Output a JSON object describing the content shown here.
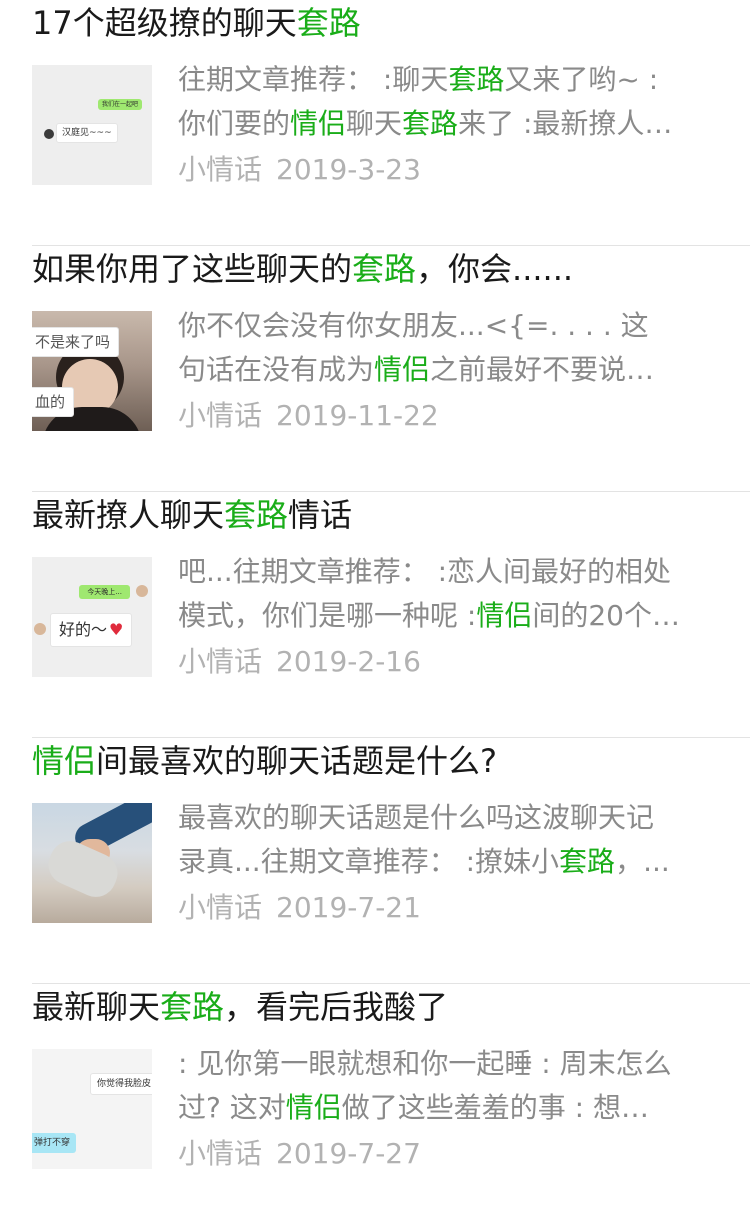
{
  "articles": [
    {
      "title_parts": [
        {
          "text": "17个超级撩的聊天",
          "hl": false
        },
        {
          "text": "套路",
          "hl": true
        }
      ],
      "desc_lines": [
        [
          {
            "text": "往期文章推荐：  :聊天",
            "hl": false
          },
          {
            "text": "套路",
            "hl": true
          },
          {
            "text": "又来了哟~ :",
            "hl": false
          }
        ],
        [
          {
            "text": "你们要的",
            "hl": false
          },
          {
            "text": "情侣",
            "hl": true
          },
          {
            "text": "聊天",
            "hl": false
          },
          {
            "text": "套路",
            "hl": true
          },
          {
            "text": "来了 :最新撩人…",
            "hl": false
          }
        ]
      ],
      "source": "小情话",
      "date": "2019-3-23",
      "thumb": {
        "kind": "chat1",
        "green_text": "我们在一起吧",
        "white_text": "汉庭见~~~"
      }
    },
    {
      "title_parts": [
        {
          "text": "如果你用了这些聊天的",
          "hl": false
        },
        {
          "text": "套路",
          "hl": true
        },
        {
          "text": "，你会......",
          "hl": false
        }
      ],
      "desc_lines": [
        [
          {
            "text": "你不仅会没有你女朋友...<{=.   .   .   .   这",
            "hl": false
          }
        ],
        [
          {
            "text": "句话在没有成为",
            "hl": false
          },
          {
            "text": "情侣",
            "hl": true
          },
          {
            "text": "之前最好不要说…",
            "hl": false
          }
        ]
      ],
      "source": "小情话",
      "date": "2019-11-22",
      "thumb": {
        "kind": "photo-girl",
        "top_text": "不是来了吗",
        "bottom_text": "血的"
      }
    },
    {
      "title_parts": [
        {
          "text": "最新撩人聊天",
          "hl": false
        },
        {
          "text": "套路",
          "hl": true
        },
        {
          "text": "情话",
          "hl": false
        }
      ],
      "desc_lines": [
        [
          {
            "text": "吧...往期文章推荐：  :恋人间最好的相处",
            "hl": false
          }
        ],
        [
          {
            "text": "模式，你们是哪一种呢 :",
            "hl": false
          },
          {
            "text": "情侣",
            "hl": true
          },
          {
            "text": "间的20个…",
            "hl": false
          }
        ]
      ],
      "source": "小情话",
      "date": "2019-2-16",
      "thumb": {
        "kind": "chat2",
        "green_text": "今天晚上...",
        "white_text": "好的～"
      }
    },
    {
      "title_parts": [
        {
          "text": "情侣",
          "hl": true
        },
        {
          "text": "间最喜欢的聊天话题是什么?",
          "hl": false
        }
      ],
      "desc_lines": [
        [
          {
            "text": "最喜欢的聊天话题是什么吗这波聊天记",
            "hl": false
          }
        ],
        [
          {
            "text": "录真...往期文章推荐：  :撩妹小",
            "hl": false
          },
          {
            "text": "套路",
            "hl": true
          },
          {
            "text": "，...",
            "hl": false
          }
        ]
      ],
      "source": "小情话",
      "date": "2019-7-21",
      "thumb": {
        "kind": "photo-hands"
      }
    },
    {
      "title_parts": [
        {
          "text": "最新聊天",
          "hl": false
        },
        {
          "text": "套路",
          "hl": true
        },
        {
          "text": "，看完后我酸了",
          "hl": false
        }
      ],
      "desc_lines": [
        [
          {
            "text": ": 见你第一眼就想和你一起睡 : 周末怎么",
            "hl": false
          }
        ],
        [
          {
            "text": "过?  这对",
            "hl": false
          },
          {
            "text": "情侣",
            "hl": true
          },
          {
            "text": "做了这些羞羞的事 : 想…",
            "hl": false
          }
        ]
      ],
      "source": "小情话",
      "date": "2019-7-27",
      "thumb": {
        "kind": "chat3",
        "white_text": "你觉得我脸皮",
        "blue_text": "弹打不穿"
      }
    }
  ],
  "colors": {
    "highlight": "#1aad19",
    "title": "#1a1a1a",
    "desc": "#8a8a8a",
    "meta": "#b2b2b2",
    "divider": "#e3e3e3"
  }
}
